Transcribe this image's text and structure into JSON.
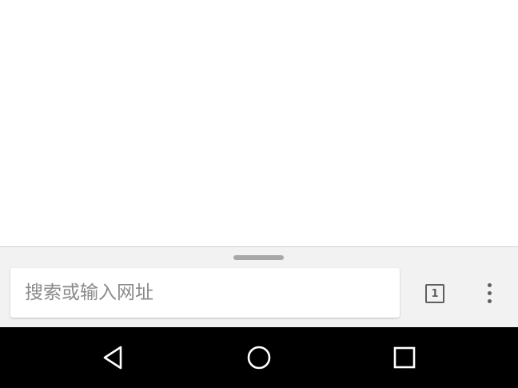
{
  "toolbar": {
    "search_placeholder": "搜索或输入网址",
    "search_value": "",
    "tab_count": "1"
  },
  "icons": {
    "drag_handle": "drag-handle-icon",
    "tab_switcher": "tab-switcher-icon",
    "menu": "more-vert-icon",
    "back": "nav-back-icon",
    "home": "nav-home-icon",
    "recents": "nav-recents-icon"
  },
  "colors": {
    "toolbar_bg": "#f2f2f2",
    "nav_bar_bg": "#000000",
    "icon_gray": "#5f5f5f",
    "placeholder_gray": "#8a8a8a"
  }
}
